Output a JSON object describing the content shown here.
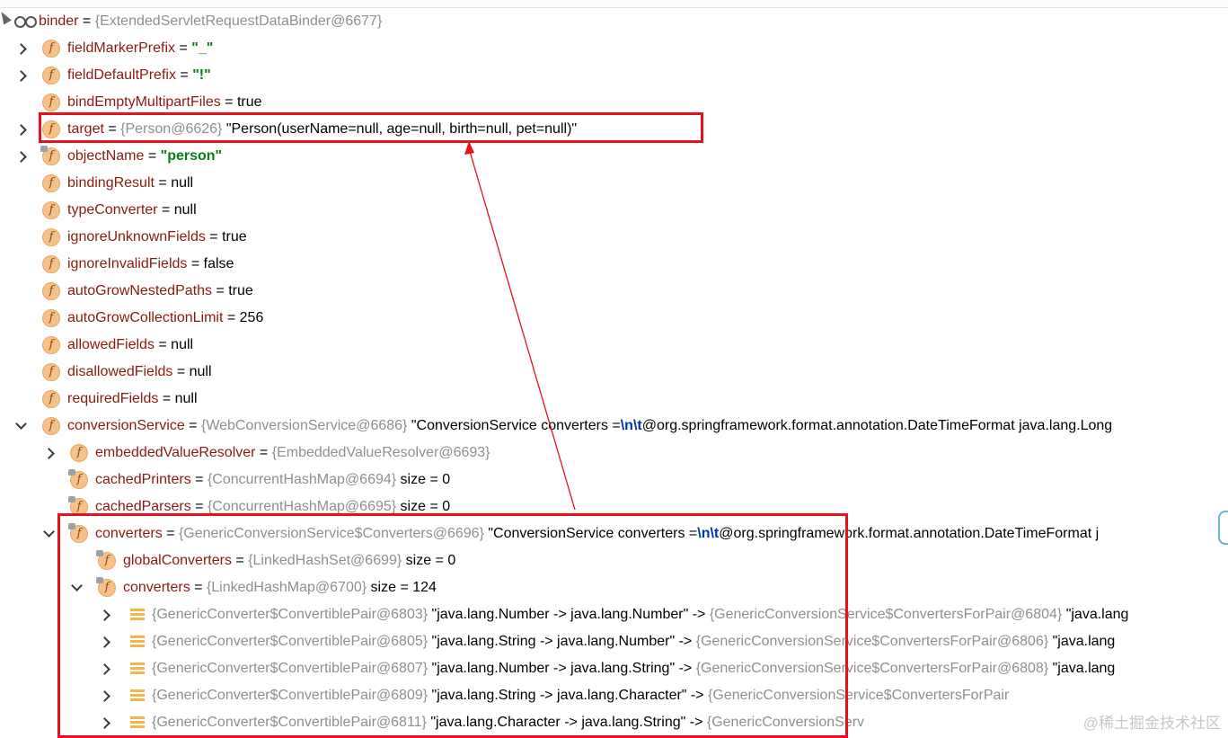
{
  "root": {
    "name": "binder",
    "value": "{ExtendedServletRequestDataBinder@6677}"
  },
  "fields": [
    {
      "name": "fieldMarkerPrefix",
      "eq": " = ",
      "value": "\"_\"",
      "kind": "str"
    },
    {
      "name": "fieldDefaultPrefix",
      "eq": " = ",
      "value": "\"!\"",
      "kind": "str"
    },
    {
      "name": "bindEmptyMultipartFiles",
      "eq": " = ",
      "value": "true",
      "kind": "plain"
    },
    {
      "name": "target",
      "eq": " = ",
      "ref": "{Person@6626}",
      "value": " \"Person(userName=null, age=null, birth=null, pet=null)\"",
      "kind": "plain"
    },
    {
      "name": "objectName",
      "eq": " = ",
      "value": "\"person\"",
      "kind": "str"
    },
    {
      "name": "bindingResult",
      "eq": " = ",
      "value": "null",
      "kind": "plain"
    },
    {
      "name": "typeConverter",
      "eq": " = ",
      "value": "null",
      "kind": "plain"
    },
    {
      "name": "ignoreUnknownFields",
      "eq": " = ",
      "value": "true",
      "kind": "plain"
    },
    {
      "name": "ignoreInvalidFields",
      "eq": " = ",
      "value": "false",
      "kind": "plain"
    },
    {
      "name": "autoGrowNestedPaths",
      "eq": " = ",
      "value": "true",
      "kind": "plain"
    },
    {
      "name": "autoGrowCollectionLimit",
      "eq": " = ",
      "value": "256",
      "kind": "plain"
    },
    {
      "name": "allowedFields",
      "eq": " = ",
      "value": "null",
      "kind": "plain"
    },
    {
      "name": "disallowedFields",
      "eq": " = ",
      "value": "null",
      "kind": "plain"
    },
    {
      "name": "requiredFields",
      "eq": " = ",
      "value": "null",
      "kind": "plain"
    }
  ],
  "conversionService": {
    "name": "conversionService",
    "ref": "{WebConversionService@6686}",
    "value_pre": " \"ConversionService converters =",
    "esc": "\\n\\t",
    "value_post": "@org.springframework.format.annotation.DateTimeFormat java.lang.Long"
  },
  "children": [
    {
      "name": "embeddedValueResolver",
      "ref": "{EmbeddedValueResolver@6693}",
      "extra": ""
    },
    {
      "name": "cachedPrinters",
      "ref": "{ConcurrentHashMap@6694}",
      "extra": "  size = 0"
    },
    {
      "name": "cachedParsers",
      "ref": "{ConcurrentHashMap@6695}",
      "extra": "  size = 0"
    }
  ],
  "converters": {
    "name": "converters",
    "ref": "{GenericConversionService$Converters@6696}",
    "value_pre": " \"ConversionService converters =",
    "esc": "\\n\\t",
    "value_post": "@org.springframework.format.annotation.DateTimeFormat j"
  },
  "globalConverters": {
    "name": "globalConverters",
    "ref": "{LinkedHashSet@6699}",
    "extra": "  size = 0"
  },
  "convertersMap": {
    "name": "converters",
    "ref": "{LinkedHashMap@6700}",
    "extra": "  size = 124"
  },
  "entries": [
    {
      "key": "{GenericConverter$ConvertiblePair@6803}",
      "str": " \"java.lang.Number -> java.lang.Number\"",
      "arrow": " -> ",
      "val": "{GenericConversionService$ConvertersForPair@6804}",
      "tail": " \"java.lang"
    },
    {
      "key": "{GenericConverter$ConvertiblePair@6805}",
      "str": " \"java.lang.String -> java.lang.Number\"",
      "arrow": " -> ",
      "val": "{GenericConversionService$ConvertersForPair@6806}",
      "tail": " \"java.lang"
    },
    {
      "key": "{GenericConverter$ConvertiblePair@6807}",
      "str": " \"java.lang.Number -> java.lang.String\"",
      "arrow": " -> ",
      "val": "{GenericConversionService$ConvertersForPair@6808}",
      "tail": " \"java.lang"
    },
    {
      "key": "{GenericConverter$ConvertiblePair@6809}",
      "str": " \"java.lang.String -> java.lang.Character\"",
      "arrow": " -> ",
      "val": "{GenericConversionService$ConvertersForPair",
      "tail": ""
    },
    {
      "key": "{GenericConverter$ConvertiblePair@6811}",
      "str": " \"java.lang.Character -> java.lang.String\"",
      "arrow": " -> ",
      "val": "{GenericConversionServ",
      "tail": ""
    }
  ],
  "watermark": "@稀土掘金技术社区",
  "colors": {
    "highlight": "#e8101a",
    "field": "#871094",
    "string": "#067d17",
    "ref": "#8f8f8f"
  }
}
